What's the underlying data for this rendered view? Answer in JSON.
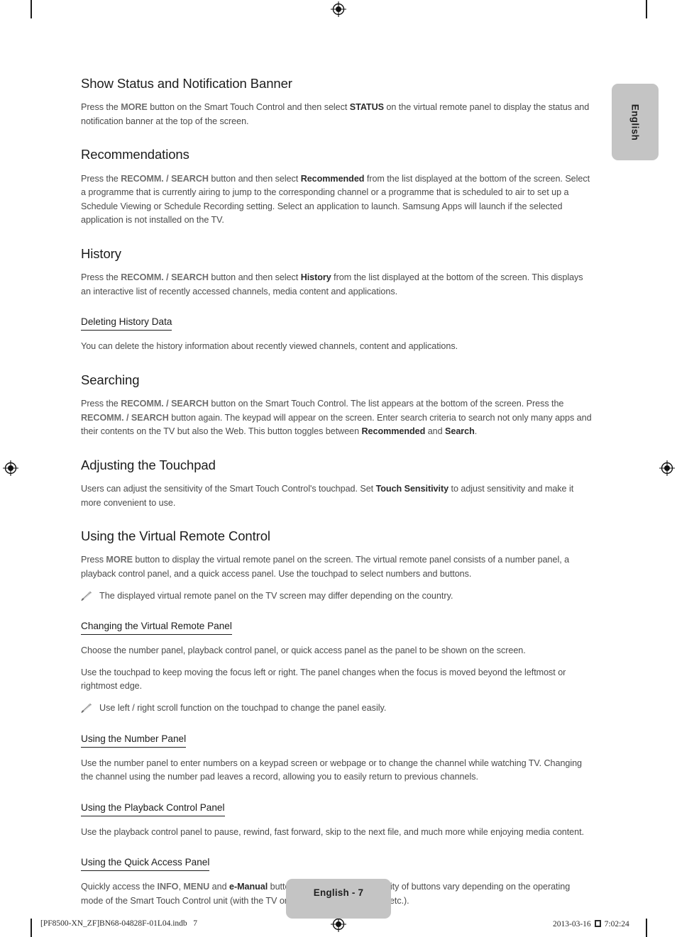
{
  "page": {
    "language_tab": "English",
    "page_badge": "English - 7",
    "production_footer_left": "[PF8500-XN_ZF]BN68-04828F-01L04.indb   7",
    "production_footer_date": "2013-03-16",
    "production_footer_time": "7:02:24"
  },
  "sections": [
    {
      "id": "show-status",
      "heading": "Show Status and Notification Banner",
      "paragraphs": [
        {
          "runs": [
            {
              "t": "Press the ",
              "s": "n"
            },
            {
              "t": "MORE",
              "s": "btn"
            },
            {
              "t": " button on the Smart Touch Control and then select ",
              "s": "n"
            },
            {
              "t": "STATUS",
              "s": "ui"
            },
            {
              "t": " on the virtual remote panel to display the status and notification banner at the top of the screen.",
              "s": "n"
            }
          ]
        }
      ]
    },
    {
      "id": "recommendations",
      "heading": "Recommendations",
      "paragraphs": [
        {
          "runs": [
            {
              "t": "Press the ",
              "s": "n"
            },
            {
              "t": "RECOMM. / SEARCH",
              "s": "btn"
            },
            {
              "t": " button and then select ",
              "s": "n"
            },
            {
              "t": "Recommended",
              "s": "ui"
            },
            {
              "t": " from the list displayed at the bottom of the screen. Select a programme that is currently airing to jump to the corresponding channel or a programme that is scheduled to air to set up a Schedule Viewing or Schedule Recording setting. Select an application to launch. Samsung Apps will launch if the selected application is not installed on the TV.",
              "s": "n"
            }
          ]
        }
      ]
    },
    {
      "id": "history",
      "heading": "History",
      "paragraphs": [
        {
          "runs": [
            {
              "t": "Press the ",
              "s": "n"
            },
            {
              "t": "RECOMM. / SEARCH",
              "s": "btn"
            },
            {
              "t": " button and then select ",
              "s": "n"
            },
            {
              "t": "History",
              "s": "ui"
            },
            {
              "t": " from the list displayed at the bottom of the screen. This displays an interactive list of recently accessed channels, media content and applications.",
              "s": "n"
            }
          ]
        }
      ],
      "subsections": [
        {
          "id": "deleting-history-data",
          "heading": "Deleting History Data",
          "paragraphs": [
            {
              "runs": [
                {
                  "t": "You can delete the history information about recently viewed channels, content and applications.",
                  "s": "n"
                }
              ]
            }
          ]
        }
      ]
    },
    {
      "id": "searching",
      "heading": "Searching",
      "paragraphs": [
        {
          "runs": [
            {
              "t": "Press the ",
              "s": "n"
            },
            {
              "t": "RECOMM. / SEARCH",
              "s": "btn"
            },
            {
              "t": " button on the Smart Touch Control. The list appears at the bottom of the screen. Press the ",
              "s": "n"
            },
            {
              "t": "RECOMM. / SEARCH",
              "s": "btn"
            },
            {
              "t": " button again. The keypad will appear on the screen. Enter search criteria to search not only many apps and their contents on the TV but also the Web. This button toggles between ",
              "s": "n"
            },
            {
              "t": "Recommended",
              "s": "ui"
            },
            {
              "t": " and ",
              "s": "n"
            },
            {
              "t": "Search",
              "s": "ui"
            },
            {
              "t": ".",
              "s": "n"
            }
          ]
        }
      ]
    },
    {
      "id": "adjusting-touchpad",
      "heading": "Adjusting the Touchpad",
      "paragraphs": [
        {
          "runs": [
            {
              "t": "Users can adjust the sensitivity of the Smart Touch Control's touchpad. Set ",
              "s": "n"
            },
            {
              "t": "Touch Sensitivity",
              "s": "ui"
            },
            {
              "t": " to adjust sensitivity and make it more convenient to use.",
              "s": "n"
            }
          ]
        }
      ]
    },
    {
      "id": "using-virtual-remote",
      "heading": "Using the Virtual Remote Control",
      "paragraphs": [
        {
          "runs": [
            {
              "t": "Press ",
              "s": "n"
            },
            {
              "t": "MORE",
              "s": "btn"
            },
            {
              "t": " button to display the virtual remote panel on the screen. The virtual remote panel consists of a number panel, a playback control panel, and a quick access panel. Use the touchpad to select numbers and buttons.",
              "s": "n"
            }
          ]
        },
        {
          "note": true,
          "runs": [
            {
              "t": "The displayed virtual remote panel on the TV screen may differ depending on the country.",
              "s": "n"
            }
          ]
        }
      ],
      "subsections": [
        {
          "id": "changing-virtual-remote-panel",
          "heading": "Changing the Virtual Remote Panel",
          "paragraphs": [
            {
              "runs": [
                {
                  "t": "Choose the number panel, playback control panel, or quick access panel as the panel to be shown on the screen.",
                  "s": "n"
                }
              ]
            },
            {
              "runs": [
                {
                  "t": "Use the touchpad to keep moving the focus left or right. The panel changes when the focus is moved beyond the leftmost or rightmost edge.",
                  "s": "n"
                }
              ]
            },
            {
              "note": true,
              "runs": [
                {
                  "t": "Use left / right scroll function on the touchpad to change the panel easily.",
                  "s": "n"
                }
              ]
            }
          ]
        },
        {
          "id": "using-number-panel",
          "heading": "Using the Number Panel",
          "paragraphs": [
            {
              "runs": [
                {
                  "t": "Use the number panel to enter numbers on a keypad screen or webpage or to change the channel while watching TV. Changing the channel using the number pad leaves a record, allowing you to easily return to previous channels.",
                  "s": "n"
                }
              ]
            }
          ]
        },
        {
          "id": "using-playback-control-panel",
          "heading": "Using the Playback Control Panel",
          "paragraphs": [
            {
              "runs": [
                {
                  "t": "Use the playback control panel to pause, rewind, fast forward, skip to the next file, and much more while enjoying media content.",
                  "s": "n"
                }
              ]
            }
          ]
        },
        {
          "id": "using-quick-access-panel",
          "heading": "Using the Quick Access Panel",
          "paragraphs": [
            {
              "runs": [
                {
                  "t": "Quickly access the ",
                  "s": "n"
                },
                {
                  "t": "INFO",
                  "s": "btn"
                },
                {
                  "t": ", ",
                  "s": "n"
                },
                {
                  "t": "MENU",
                  "s": "btn"
                },
                {
                  "t": " and ",
                  "s": "n"
                },
                {
                  "t": "e-Manual",
                  "s": "ui"
                },
                {
                  "t": " buttons. However, the availability of buttons vary depending on the operating mode of the Smart Touch Control unit (with the TV only, as a universal remote, etc.).",
                  "s": "n"
                }
              ]
            }
          ]
        }
      ]
    }
  ],
  "colors": {
    "body_text": "#4a4a4a",
    "heading_text": "#1c1c1c",
    "button_ref": "#6e6e6e",
    "ui_ref": "#2b2b2b",
    "badge_bg": "#c4c4c4"
  }
}
